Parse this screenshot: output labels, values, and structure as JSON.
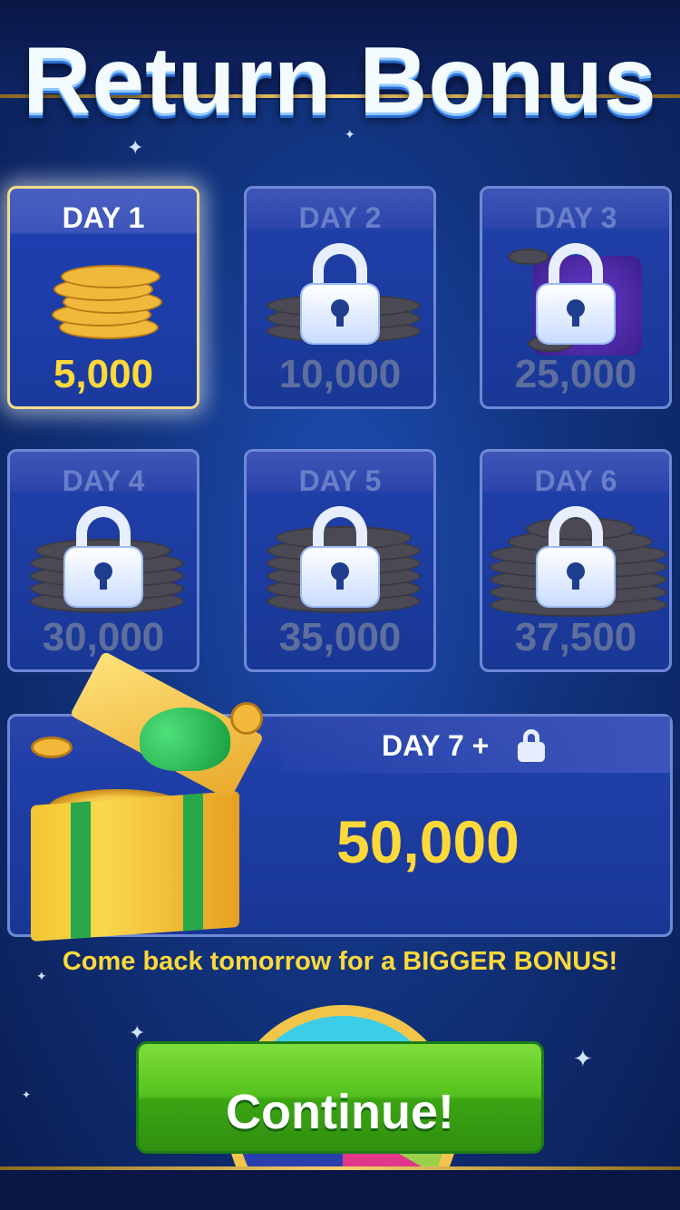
{
  "title": "Return Bonus",
  "days": [
    {
      "label": "DAY 1",
      "amount": "5,000",
      "locked": false
    },
    {
      "label": "DAY 2",
      "amount": "10,000",
      "locked": true
    },
    {
      "label": "DAY 3",
      "amount": "25,000",
      "locked": true
    },
    {
      "label": "DAY 4",
      "amount": "30,000",
      "locked": true
    },
    {
      "label": "DAY 5",
      "amount": "35,000",
      "locked": true
    },
    {
      "label": "DAY 6",
      "amount": "37,500",
      "locked": true
    }
  ],
  "day7": {
    "label": "DAY 7 +",
    "amount": "50,000",
    "icon": "lock-icon"
  },
  "message": "Come back tomorrow for a BIGGER BONUS!",
  "continue_label": "Continue!",
  "colors": {
    "accent_gold": "#ffd93a",
    "button_green": "#56c21f",
    "panel_blue": "#1f3fa8"
  }
}
